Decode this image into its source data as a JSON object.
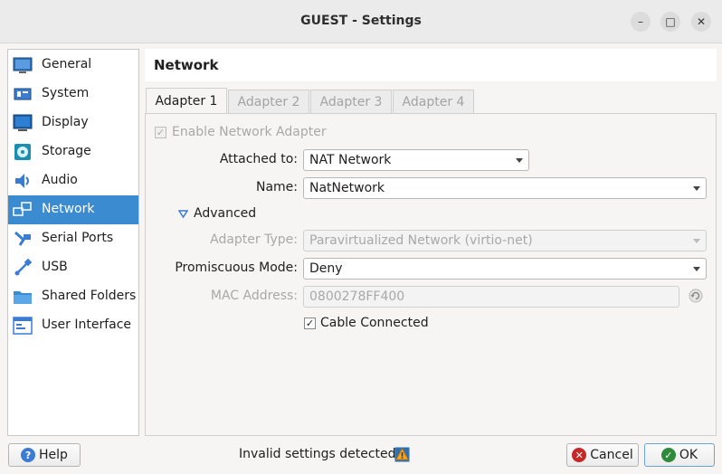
{
  "window": {
    "title": "GUEST - Settings",
    "controls": {
      "minimize": "–",
      "maximize": "□",
      "close": "✕"
    }
  },
  "sidebar": {
    "items": [
      {
        "label": "General",
        "icon": "general-icon"
      },
      {
        "label": "System",
        "icon": "system-icon"
      },
      {
        "label": "Display",
        "icon": "display-icon"
      },
      {
        "label": "Storage",
        "icon": "storage-icon"
      },
      {
        "label": "Audio",
        "icon": "audio-icon"
      },
      {
        "label": "Network",
        "icon": "network-icon",
        "selected": true
      },
      {
        "label": "Serial Ports",
        "icon": "serial-ports-icon"
      },
      {
        "label": "USB",
        "icon": "usb-icon"
      },
      {
        "label": "Shared Folders",
        "icon": "shared-folders-icon"
      },
      {
        "label": "User Interface",
        "icon": "user-interface-icon"
      }
    ]
  },
  "page": {
    "title": "Network"
  },
  "tabs": [
    "Adapter 1",
    "Adapter 2",
    "Adapter 3",
    "Adapter 4"
  ],
  "adapter": {
    "enable_label": "Enable Network Adapter",
    "attached_label": "Attached to:",
    "attached_value": "NAT Network",
    "name_label": "Name:",
    "name_value": "NatNetwork",
    "advanced_label": "Advanced",
    "adapter_type_label": "Adapter Type:",
    "adapter_type_value": "Paravirtualized Network (virtio-net)",
    "promiscuous_label": "Promiscuous Mode:",
    "promiscuous_value": "Deny",
    "mac_label": "MAC Address:",
    "mac_value": "0800278FF400",
    "cable_label": "Cable Connected",
    "enable_checked": "✓",
    "cable_checked": "✓"
  },
  "footer": {
    "help_label": "Help",
    "status_text": "Invalid settings detected",
    "cancel_label": "Cancel",
    "ok_label": "OK"
  },
  "colors": {
    "accent": "#3a8bd0",
    "cancel_icon": "#c62828",
    "ok_icon": "#2e8b3a",
    "help_icon": "#3a7bd5",
    "warning": "#e07b00"
  }
}
